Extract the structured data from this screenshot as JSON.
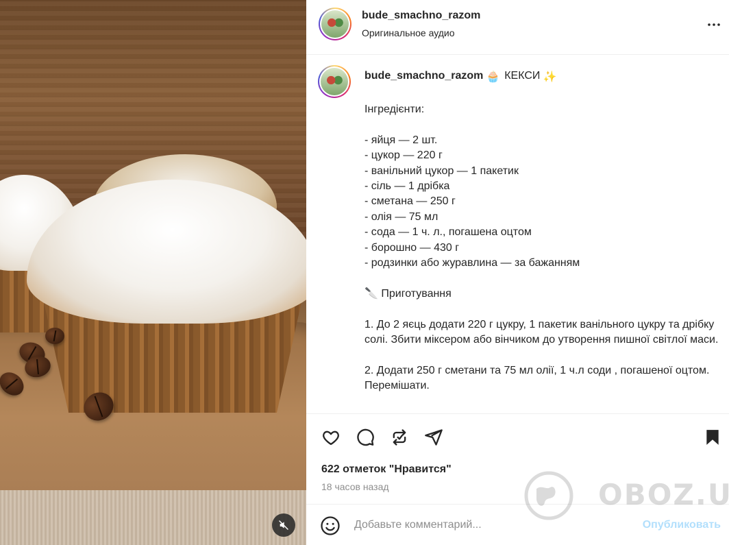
{
  "header": {
    "username": "bude_smachno_razom",
    "audio": "Оригинальное аудио",
    "avatar_icon": "avatar-image",
    "more_icon": "more-horizontal-icon"
  },
  "caption": {
    "username": "bude_smachno_razom",
    "emoji_1": "🧁",
    "title": "КЕКСИ",
    "emoji_2": "✨",
    "body": "Інгредієнти:\n\n- яйця — 2 шт.\n- цукор — 220 г\n- ванільний цукор — 1 пакетик\n- сіль — 1 дрібка\n- сметана — 250 г\n- олія — 75 мл\n- сода — 1 ч. л., погашена оцтом\n- борошно — 430 г\n- родзинки або журавлина — за бажанням\n\n🔪 Приготування\n\n1. До 2 яєць додати 220 г цукру, 1 пакетик ванільного цукру та дрібку солі. Збити міксером або вінчиком до утворення пишної світлої маси.\n\n2. Додати 250 г сметани та 75 мл олії, 1 ч.л соди , погашеної оцтом. Перемішати."
  },
  "actions": {
    "icons": [
      "heart-icon",
      "comment-icon",
      "repost-icon",
      "share-icon",
      "bookmark-icon"
    ]
  },
  "likes": "622 отметок \"Нравится\"",
  "time_ago": "18 часов назад",
  "comment": {
    "placeholder": "Добавьте комментарий...",
    "publish": "Опубликовать"
  },
  "watermark": "OBOZ.UA",
  "colors": {
    "text": "#262626",
    "secondary": "#8e8e8e",
    "publish_disabled": "#b2dffc",
    "divider": "#efefef"
  }
}
